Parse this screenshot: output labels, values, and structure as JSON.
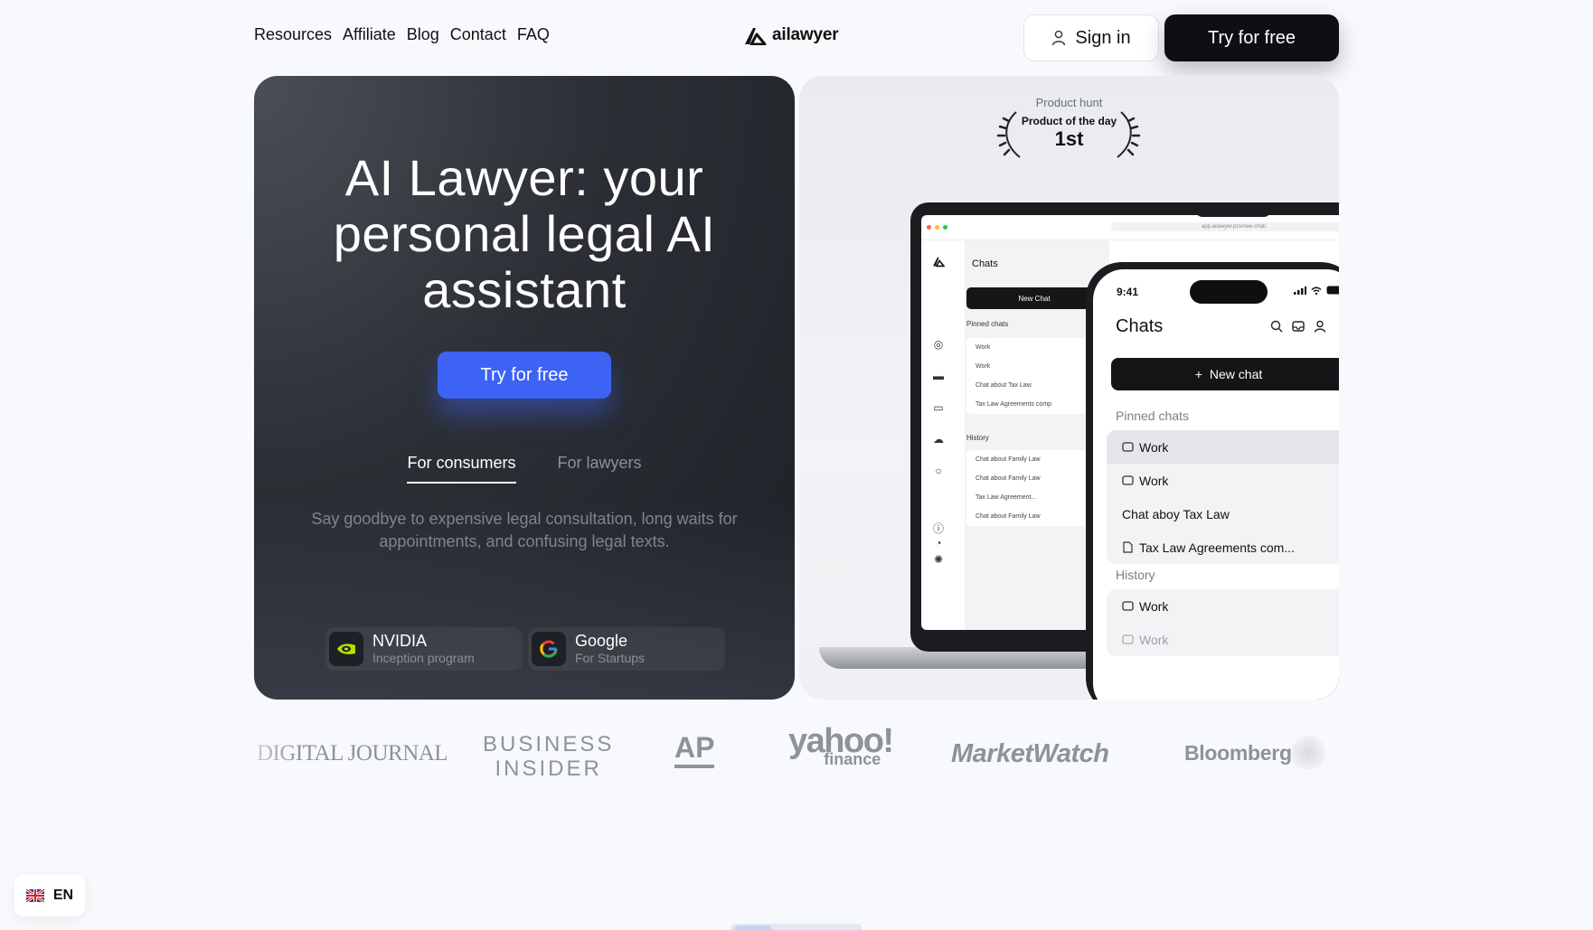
{
  "nav": {
    "links": [
      "Resources",
      "Affiliate",
      "Blog",
      "Contact",
      "FAQ"
    ],
    "logo_text": "ailawyer",
    "signin_label": "Sign in",
    "try_label": "Try for free"
  },
  "hero": {
    "title_line1": "AI Lawyer: your",
    "title_line2": "personal legal AI",
    "title_line3": "assistant",
    "cta_label": "Try for free",
    "tabs": [
      "For consumers",
      "For lawyers"
    ],
    "description": "Say goodbye to expensive legal consultation, long waits for appointments, and confusing legal texts.",
    "partners": [
      {
        "name": "NVIDIA",
        "sub": "Inception program"
      },
      {
        "name": "Google",
        "sub": "For Startups"
      }
    ]
  },
  "badge": {
    "top": "Product hunt",
    "middle": "Product of the day",
    "rank": "1st"
  },
  "laptop_app": {
    "url": "app.ailawyer.pro/new-chat/",
    "chats_title": "Chats",
    "new_chat": "New Chat",
    "pinned_label": "Pinned chats",
    "pinned": [
      "Work",
      "Work",
      "Chat about Tax Law",
      "Tax Law Agreements comp"
    ],
    "history_label": "History",
    "history": [
      "Chat about Family Law",
      "Chat about Family Law",
      "Tax Law Agreement...",
      "Chat about Family Law"
    ]
  },
  "phone_app": {
    "time": "9:41",
    "title": "Chats",
    "new_chat": "New chat",
    "pinned_label": "Pinned chats",
    "pinned": [
      "Work",
      "Work",
      "Chat aboy Tax Law",
      "Tax Law Agreements com..."
    ],
    "history_label": "History",
    "history": [
      "Work",
      "Work"
    ]
  },
  "press": [
    "DIGITAL JOURNAL",
    "BUSINESS",
    "INSIDER",
    "AP",
    "yahoo!",
    "finance",
    "MarketWatch",
    "Bloomberg"
  ],
  "language": {
    "code": "EN"
  },
  "colors": {
    "accent": "#3d63f5",
    "dark": "#0e0f12",
    "page_bg": "#f7f9fc"
  }
}
